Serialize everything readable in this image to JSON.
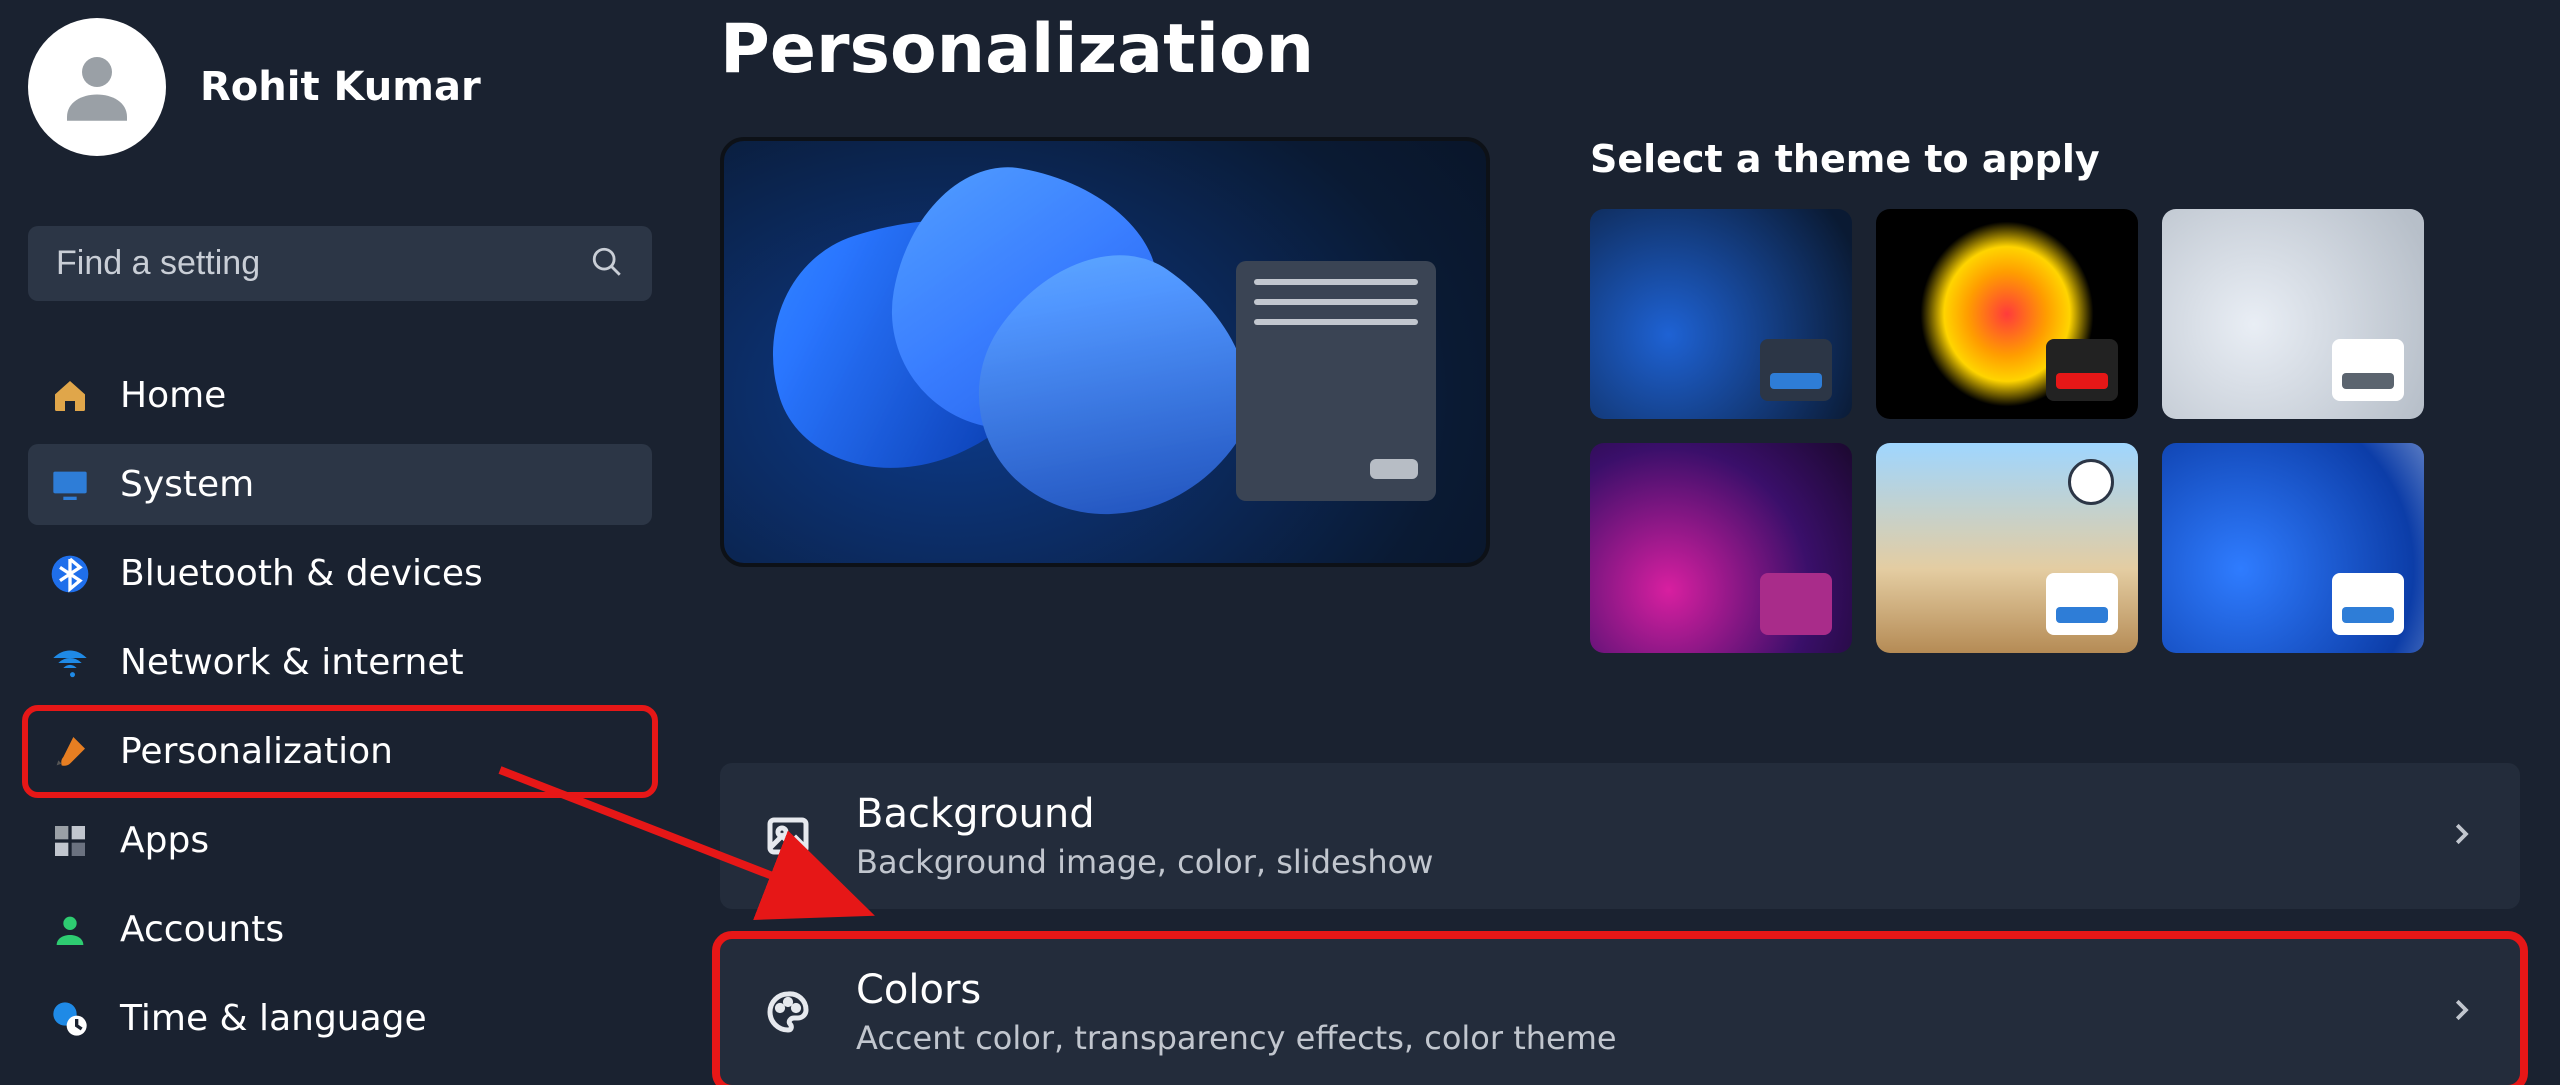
{
  "user": {
    "name": "Rohit Kumar"
  },
  "search": {
    "placeholder": "Find a setting"
  },
  "nav": {
    "items": [
      {
        "id": "home",
        "label": "Home"
      },
      {
        "id": "system",
        "label": "System"
      },
      {
        "id": "bt",
        "label": "Bluetooth & devices"
      },
      {
        "id": "net",
        "label": "Network & internet"
      },
      {
        "id": "pers",
        "label": "Personalization"
      },
      {
        "id": "apps",
        "label": "Apps"
      },
      {
        "id": "acct",
        "label": "Accounts"
      },
      {
        "id": "time",
        "label": "Time & language"
      }
    ],
    "active_id": "system",
    "highlighted_id": "pers"
  },
  "page": {
    "title": "Personalization",
    "themes_heading": "Select a theme to apply",
    "themes": [
      {
        "id": "bloom-dark"
      },
      {
        "id": "glow"
      },
      {
        "id": "bloom-light"
      },
      {
        "id": "purple-glow"
      },
      {
        "id": "sunrise"
      },
      {
        "id": "bloom-blue-light"
      }
    ],
    "settings": [
      {
        "id": "background",
        "title": "Background",
        "desc": "Background image, color, slideshow"
      },
      {
        "id": "colors",
        "title": "Colors",
        "desc": "Accent color, transparency effects, color theme",
        "highlighted": true
      }
    ]
  },
  "accent": "#2e7dd7",
  "highlight_color": "#e61717"
}
